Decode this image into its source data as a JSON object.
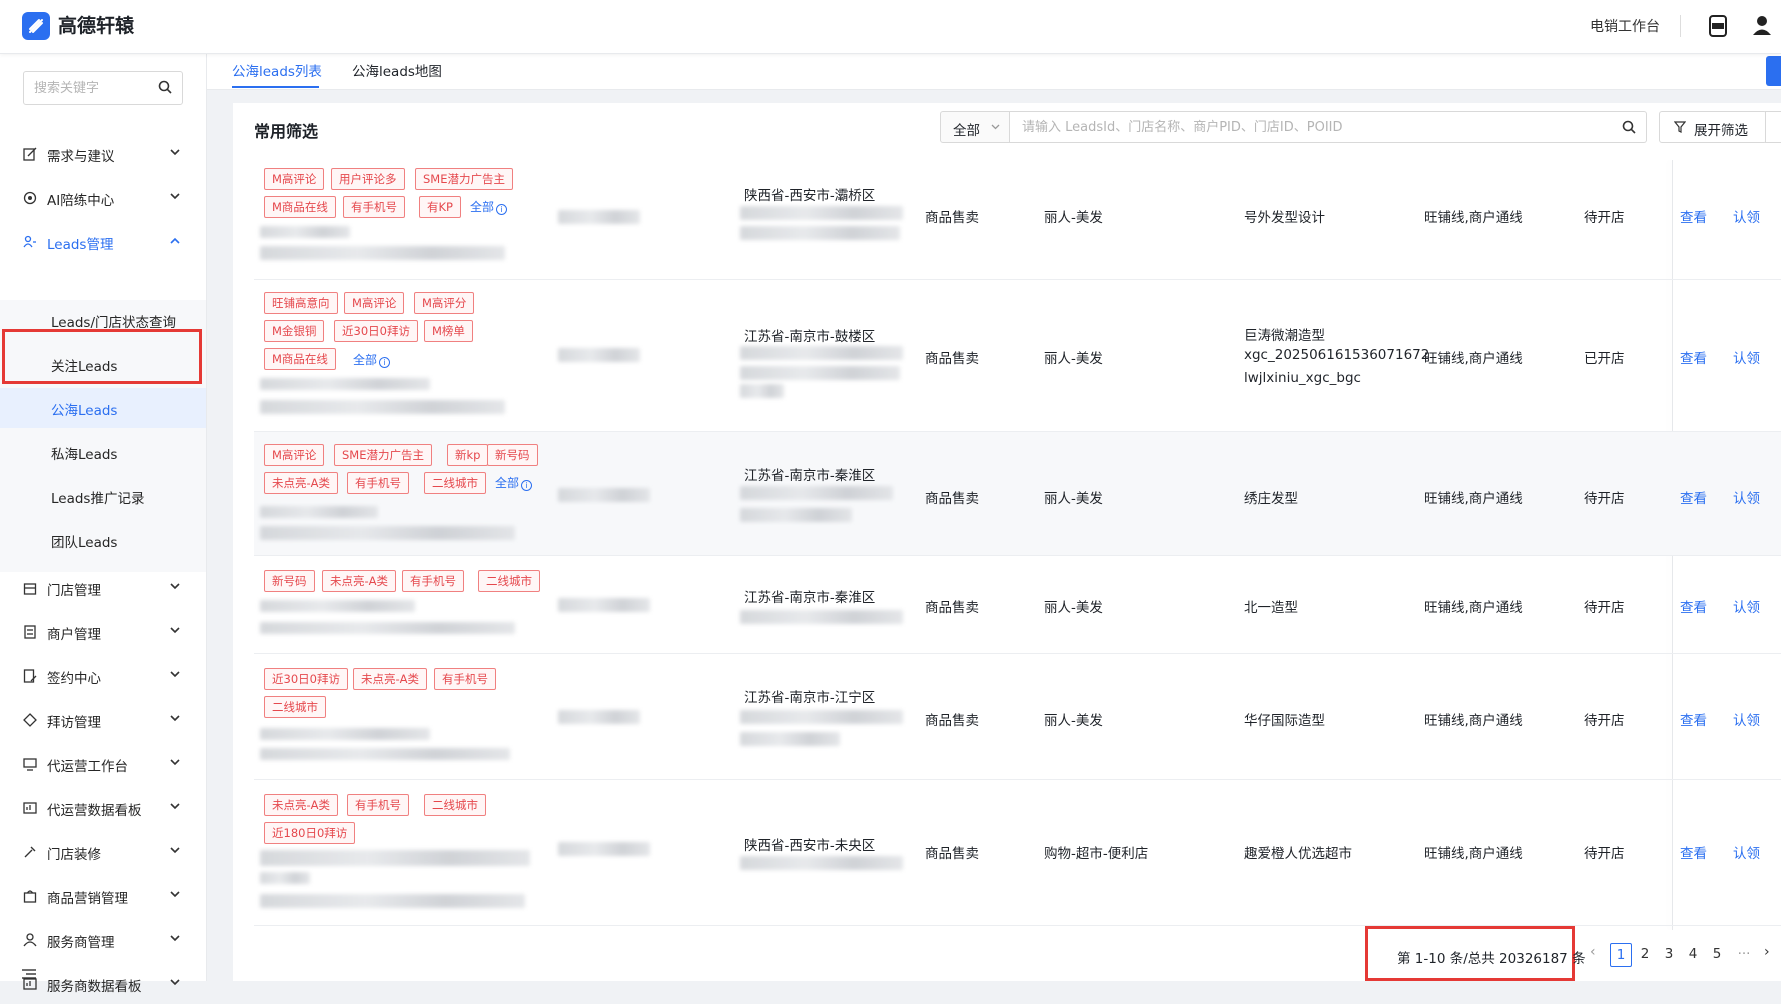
{
  "app": {
    "brand": "高德轩辕",
    "workbench": "电销工作台"
  },
  "sidebar": {
    "search_placeholder": "搜索关键字",
    "items": [
      {
        "label": "需求与建议"
      },
      {
        "label": "AI陪练中心"
      },
      {
        "label": "Leads管理"
      },
      {
        "label": "门店管理"
      },
      {
        "label": "商户管理"
      },
      {
        "label": "签约中心"
      },
      {
        "label": "拜访管理"
      },
      {
        "label": "代运营工作台"
      },
      {
        "label": "代运营数据看板"
      },
      {
        "label": "门店装修"
      },
      {
        "label": "商品营销管理"
      },
      {
        "label": "服务商管理"
      },
      {
        "label": "服务商数据看板"
      }
    ],
    "sub_items": [
      {
        "label": "Leads/门店状态查询"
      },
      {
        "label": "关注Leads"
      },
      {
        "label": "公海Leads"
      },
      {
        "label": "私海Leads"
      },
      {
        "label": "Leads推广记录"
      },
      {
        "label": "团队Leads"
      }
    ]
  },
  "tabs": [
    {
      "label": "公海leads列表"
    },
    {
      "label": "公海leads地图"
    }
  ],
  "filter": {
    "title": "常用筛选",
    "select_value": "全部",
    "search_placeholder": "请输入 LeadsId、门店名称、商户PID、门店ID、POIID",
    "expand_label": "展开筛选"
  },
  "table": {
    "all_label": "全部",
    "view_label": "查看",
    "claim_label": "认领",
    "rows": [
      {
        "tags": [
          "M高评论",
          "用户评论多",
          "SME潜力广告主",
          "M商品在线",
          "有手机号",
          "有KP"
        ],
        "region": "陕西省-西安市-灞桥区",
        "type": "商品售卖",
        "category": "丽人-美发",
        "name": [
          "号外发型设计"
        ],
        "line": "旺铺线,商户通线",
        "status": "待开店"
      },
      {
        "tags": [
          "旺铺高意向",
          "M高评论",
          "M高评分",
          "M金银铜",
          "近30日0拜访",
          "M榜单",
          "M商品在线"
        ],
        "region": "江苏省-南京市-鼓楼区",
        "type": "商品售卖",
        "category": "丽人-美发",
        "name": [
          "巨涛微潮造型",
          "xgc_20250616153607167​2",
          "lwjlxiniu_xgc_bgc"
        ],
        "line": "旺铺线,商户通线",
        "status": "已开店"
      },
      {
        "tags": [
          "M高评论",
          "SME潜力广告主",
          "新kp",
          "新号码",
          "未点亮-A类",
          "有手机号",
          "二线城市"
        ],
        "region": "江苏省-南京市-秦淮区",
        "type": "商品售卖",
        "category": "丽人-美发",
        "name": [
          "绣庄发型"
        ],
        "line": "旺铺线,商户通线",
        "status": "待开店"
      },
      {
        "tags": [
          "新号码",
          "未点亮-A类",
          "有手机号",
          "二线城市"
        ],
        "region": "江苏省-南京市-秦淮区",
        "type": "商品售卖",
        "category": "丽人-美发",
        "name": [
          "北一造型"
        ],
        "line": "旺铺线,商户通线",
        "status": "待开店"
      },
      {
        "tags": [
          "近30日0拜访",
          "未点亮-A类",
          "有手机号",
          "二线城市"
        ],
        "region": "江苏省-南京市-江宁区",
        "type": "商品售卖",
        "category": "丽人-美发",
        "name": [
          "华仔国际造型"
        ],
        "line": "旺铺线,商户通线",
        "status": "待开店"
      },
      {
        "tags": [
          "未点亮-A类",
          "有手机号",
          "二线城市",
          "近180日0拜访"
        ],
        "region": "陕西省-西安市-未央区",
        "type": "商品售卖",
        "category": "购物-超市-便利店",
        "name": [
          "趣爱橙人优选超市"
        ],
        "line": "旺铺线,商户通线",
        "status": "待开店"
      }
    ]
  },
  "pagination": {
    "summary": "第 1-10 条/总共 20326187 条",
    "pages": [
      "1",
      "2",
      "3",
      "4",
      "5"
    ],
    "current": 1,
    "ellipsis": "···"
  }
}
